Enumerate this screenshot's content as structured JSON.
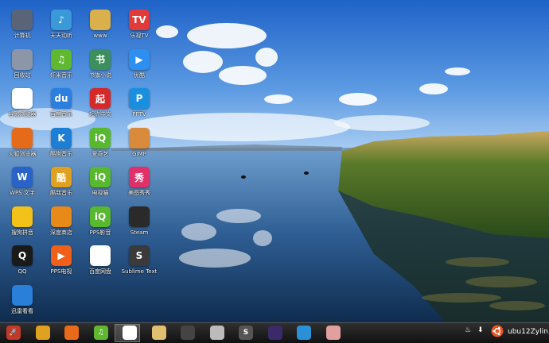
{
  "desktop": {
    "icons": [
      {
        "label": "计算机",
        "glyph": "",
        "color": "#5a6478",
        "icon": "computer-icon"
      },
      {
        "label": "天天动听",
        "glyph": "♪",
        "color": "#3a9ad9",
        "icon": "music-player-icon"
      },
      {
        "label": "www",
        "glyph": "",
        "color": "#d9b04c",
        "icon": "folder-icon"
      },
      {
        "label": "乐视TV",
        "glyph": "TV",
        "color": "#e23a3a",
        "icon": "letv-icon"
      },
      {
        "label": "回收站",
        "glyph": "",
        "color": "#8b96a8",
        "icon": "trash-icon"
      },
      {
        "label": "虾米音乐",
        "glyph": "♫",
        "color": "#5fb830",
        "icon": "xiami-icon"
      },
      {
        "label": "书旗小说",
        "glyph": "书",
        "color": "#3c8f5c",
        "icon": "book-icon"
      },
      {
        "label": "优酷",
        "glyph": "▶",
        "color": "#2d8ff0",
        "icon": "youku-icon"
      },
      {
        "label": "谷歌浏览器",
        "glyph": "",
        "color": "#ffffff",
        "icon": "chrome-icon"
      },
      {
        "label": "百度音乐",
        "glyph": "du",
        "color": "#2a7fe0",
        "icon": "baidu-music-icon"
      },
      {
        "label": "起点中文",
        "glyph": "起",
        "color": "#d42a2a",
        "icon": "qidian-icon"
      },
      {
        "label": "PPTV",
        "glyph": "P",
        "color": "#1a8fe0",
        "icon": "pptv-icon"
      },
      {
        "label": "火狐浏览器",
        "glyph": "",
        "color": "#e56a1a",
        "icon": "firefox-icon"
      },
      {
        "label": "酷狗音乐",
        "glyph": "K",
        "color": "#1b7fd8",
        "icon": "kugou-icon"
      },
      {
        "label": "爱奇艺",
        "glyph": "iQ",
        "color": "#58b82e",
        "icon": "iqiyi-icon"
      },
      {
        "label": "GIMP",
        "glyph": "",
        "color": "#d98a3a",
        "icon": "gimp-icon"
      },
      {
        "label": "WPS 文字",
        "glyph": "W",
        "color": "#2a63c8",
        "icon": "wps-icon"
      },
      {
        "label": "酷我音乐",
        "glyph": "酷",
        "color": "#e0a020",
        "icon": "kuwo-icon"
      },
      {
        "label": "电视猫",
        "glyph": "iQ",
        "color": "#58b82e",
        "icon": "tv-cat-icon"
      },
      {
        "label": "美图秀秀",
        "glyph": "秀",
        "color": "#e0306a",
        "icon": "meitu-icon"
      },
      {
        "label": "搜狗拼音",
        "glyph": "",
        "color": "#f3c21a",
        "icon": "smiley-icon"
      },
      {
        "label": "深度商店",
        "glyph": "",
        "color": "#e88a1a",
        "icon": "store-icon"
      },
      {
        "label": "PPS影音",
        "glyph": "iQ",
        "color": "#58b82e",
        "icon": "pps-icon"
      },
      {
        "label": "Steam",
        "glyph": "",
        "color": "#2a2a2a",
        "icon": "steam-icon"
      },
      {
        "label": "QQ",
        "glyph": "Q",
        "color": "#1a1a1a",
        "icon": "qq-icon"
      },
      {
        "label": "PPS电视",
        "glyph": "▶",
        "color": "#f0601a",
        "icon": "pps-tv-icon"
      },
      {
        "label": "百度网盘",
        "glyph": "",
        "color": "#ffffff",
        "icon": "baidu-pan-icon"
      },
      {
        "label": "Sublime Text",
        "glyph": "S",
        "color": "#3a3a3a",
        "icon": "sublime-icon"
      },
      {
        "label": "迅雷看看",
        "glyph": "",
        "color": "#2a7fd8",
        "icon": "xunlei-icon"
      }
    ]
  },
  "taskbar": {
    "apps": [
      {
        "icon": "launcher-rocket-icon",
        "color": "#c0392b",
        "glyph": "🚀"
      },
      {
        "icon": "kuwo-taskbar-icon",
        "color": "#e0a020",
        "glyph": ""
      },
      {
        "icon": "store-taskbar-icon",
        "color": "#e86a1a",
        "glyph": ""
      },
      {
        "icon": "xiami-taskbar-icon",
        "color": "#5fb830",
        "glyph": "♫"
      },
      {
        "icon": "chrome-taskbar-icon",
        "color": "#ffffff",
        "glyph": ""
      },
      {
        "icon": "photos-taskbar-icon",
        "color": "#e0c070",
        "glyph": ""
      },
      {
        "icon": "terminal-taskbar-icon",
        "color": "#444444",
        "glyph": ""
      },
      {
        "icon": "settings-taskbar-icon",
        "color": "#bbbbbb",
        "glyph": ""
      },
      {
        "icon": "sublime-taskbar-icon",
        "color": "#555555",
        "glyph": "S"
      },
      {
        "icon": "media-player-taskbar-icon",
        "color": "#3a2a6a",
        "glyph": ""
      },
      {
        "icon": "deepin-music-taskbar-icon",
        "color": "#2a90d8",
        "glyph": ""
      },
      {
        "icon": "people-taskbar-icon",
        "color": "#e0a0a0",
        "glyph": ""
      }
    ],
    "username": "ubu12Zylin"
  }
}
